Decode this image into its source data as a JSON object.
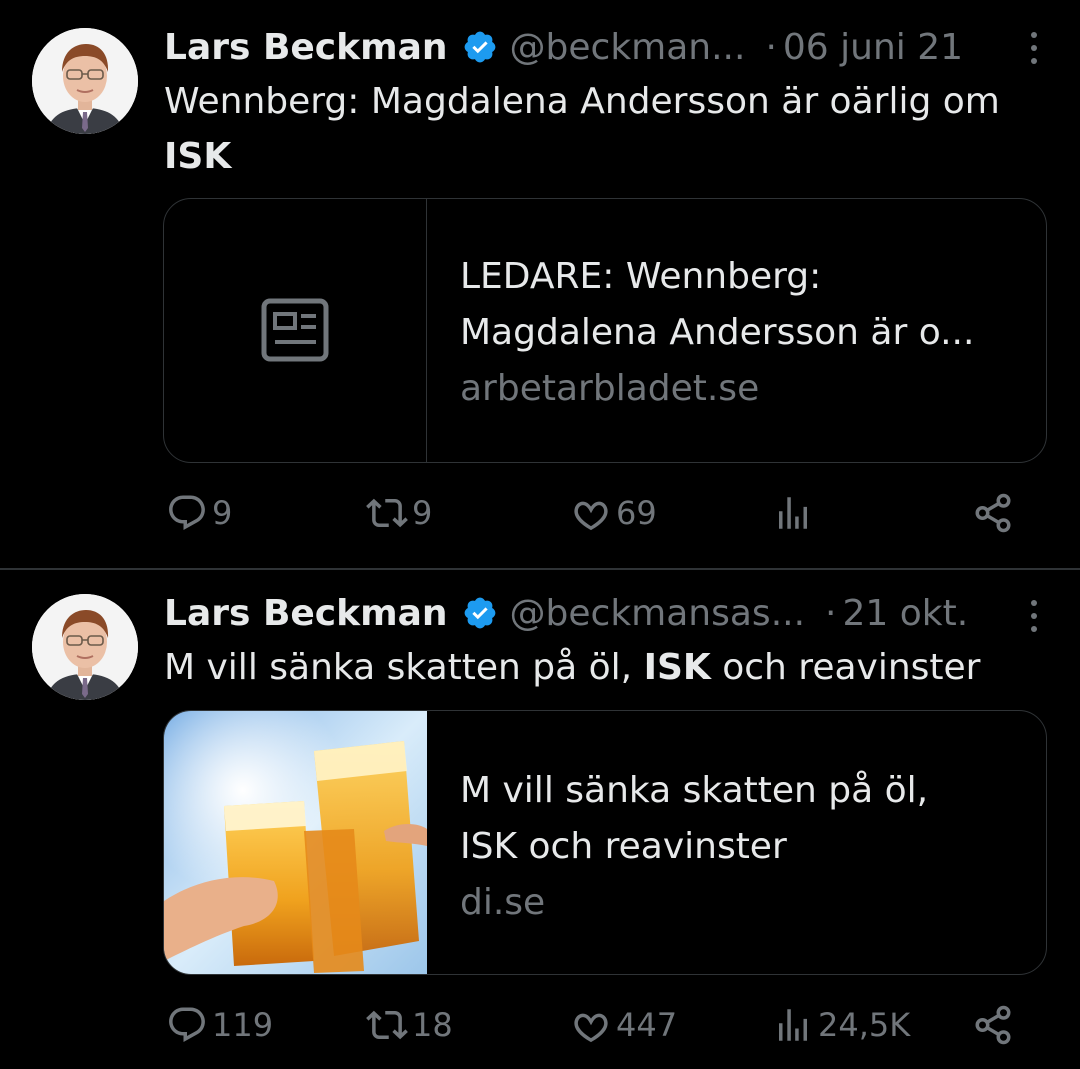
{
  "tweets": [
    {
      "author_name": "Lars Beckman",
      "handle": "@beckman...",
      "separator": "·",
      "date": "06 juni 21",
      "text_before": "Wennberg: Magdalena Andersson är oärlig om",
      "text_bold": "ISK",
      "text_after": "",
      "card": {
        "title_line1": "LEDARE: Wennberg:",
        "title_line2": "Magdalena Andersson är o...",
        "domain": "arbetarbladet.se",
        "thumbnail": "newspaper-icon"
      },
      "stats": {
        "replies": "9",
        "retweets": "9",
        "likes": "69",
        "views": ""
      }
    },
    {
      "author_name": "Lars Beckman",
      "handle": "@beckmansas...",
      "separator": "·",
      "date": "21 okt.",
      "text_before": "M vill sänka skatten på öl, ",
      "text_bold": "ISK",
      "text_after": " och reavinster",
      "card": {
        "title_line1": "M vill sänka skatten på öl,",
        "title_line2": "ISK och reavinster",
        "domain": "di.se",
        "thumbnail": "beer-glasses-photo"
      },
      "stats": {
        "replies": "119",
        "retweets": "18",
        "likes": "447",
        "views": "24,5K"
      }
    }
  ],
  "colors": {
    "background": "#000000",
    "text_primary": "#e7e9ea",
    "text_secondary": "#71767b",
    "border": "#2f3336",
    "verified": "#1d9bf0"
  },
  "icons": [
    "verified-badge-icon",
    "more-icon",
    "reply-icon",
    "retweet-icon",
    "like-icon",
    "views-icon",
    "share-icon"
  ]
}
